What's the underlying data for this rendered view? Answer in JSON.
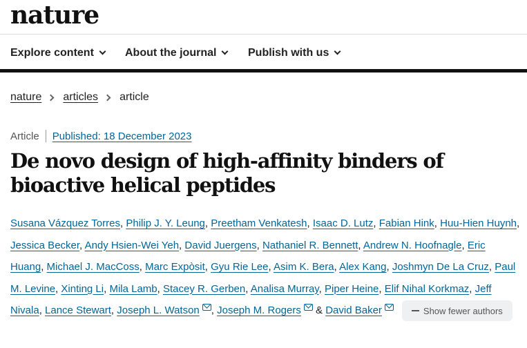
{
  "site": {
    "logo": "nature"
  },
  "nav": {
    "items": [
      {
        "label": "Explore content"
      },
      {
        "label": "About the journal"
      },
      {
        "label": "Publish with us"
      }
    ]
  },
  "breadcrumb": {
    "items": [
      "nature",
      "articles"
    ],
    "current": "article"
  },
  "article": {
    "type": "Article",
    "published": "Published: 18 December 2023",
    "title": "De novo design of high-affinity binders of bioactive helical peptides"
  },
  "authors": {
    "list": [
      "Susana Vázquez Torres",
      "Philip J. Y. Leung",
      "Preetham Venkatesh",
      "Isaac D. Lutz",
      "Fabian Hink",
      "Huu-Hien Huynh",
      "Jessica Becker",
      "Andy Hsien-Wei Yeh",
      "David Juergens",
      "Nathaniel R. Bennett",
      "Andrew N. Hoofnagle",
      "Eric Huang",
      "Michael J. MacCoss",
      "Marc Expòsit",
      "Gyu Rie Lee",
      "Asim K. Bera",
      "Alex Kang",
      "Joshmyn De La Cruz",
      "Paul M. Levine",
      "Xinting Li",
      "Mila Lamb",
      "Stacey R. Gerben",
      "Analisa Murray",
      "Piper Heine",
      "Elif Nihal Korkmaz",
      "Jeff Nivala",
      "Lance Stewart",
      "Joseph L. Watson",
      "Joseph M. Rogers",
      "David Baker"
    ],
    "corresponding": [
      "Joseph L. Watson",
      "Joseph M. Rogers",
      "David Baker"
    ],
    "show_fewer_label": "Show fewer authors",
    "separator": ",",
    "last_connector": "&"
  },
  "colors": {
    "link": "#006699",
    "nav_border": "#111111",
    "button_bg": "#eef0f2"
  }
}
